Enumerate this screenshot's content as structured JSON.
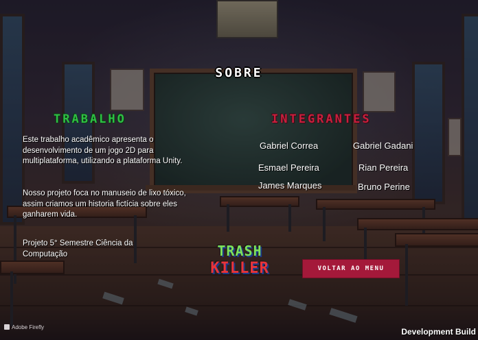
{
  "screen": {
    "title": "SOBRE",
    "colors": {
      "trabalho_heading": "#2fbf45",
      "integrantes_heading": "#c8203e",
      "button_bg": "#a4193a"
    }
  },
  "trabalho": {
    "heading": "TRABALHO",
    "paragraph1": "Este trabalho acadêmico apresenta o desenvolvimento de um jogo 2D para multiplataforma, utilizando a plataforma Unity.",
    "paragraph2": "Nosso projeto foca no manuseio de lixo tóxico, assim criamos um historia fictícia sobre eles ganharem vida.",
    "paragraph3": "Projeto 5° Semestre Ciência da Computação"
  },
  "integrantes": {
    "heading": "INTEGRANTES",
    "members": [
      "Gabriel Correa",
      "Gabriel Gadani",
      "Esmael Pereira",
      "Rian Pereira",
      "James Marques",
      "Bruno Perine"
    ]
  },
  "logo": {
    "line1": "TRASH",
    "line2": "KILLER"
  },
  "buttons": {
    "back_label": "VOLTAR AO MENU"
  },
  "watermarks": {
    "firefly": "Adobe Firefly",
    "firefly_icon": "adobe-firefly-icon",
    "dev_build": "Development Build"
  }
}
